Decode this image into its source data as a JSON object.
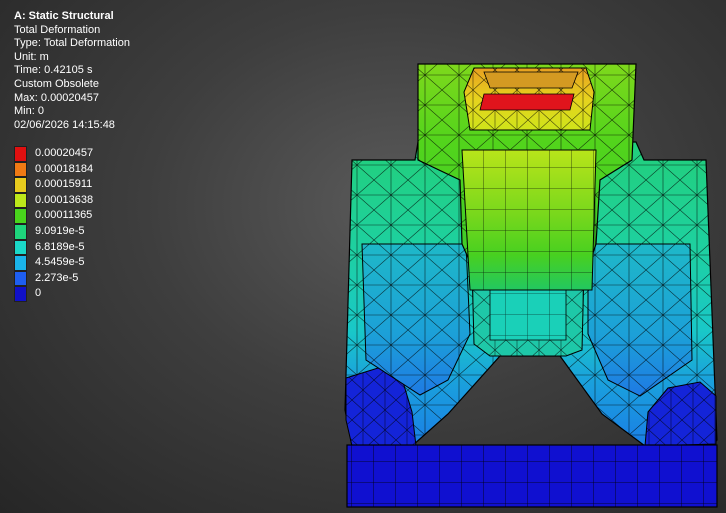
{
  "header": {
    "title": "A: Static Structural",
    "lines": [
      "Total Deformation",
      "Type: Total Deformation",
      "Unit: m",
      "Time: 0.42105 s",
      "Custom Obsolete",
      "Max: 0.00020457",
      "Min: 0",
      "02/06/2026 14:15:48"
    ]
  },
  "legend": {
    "levels": [
      {
        "label": "0.00020457",
        "color": "#e01010"
      },
      {
        "label": "0.00018184",
        "color": "#f07a14"
      },
      {
        "label": "0.00015911",
        "color": "#e8cc1e"
      },
      {
        "label": "0.00013638",
        "color": "#bde81a"
      },
      {
        "label": "0.00011365",
        "color": "#49d41c"
      },
      {
        "label": "9.0919e-5",
        "color": "#1ed47c"
      },
      {
        "label": "6.8189e-5",
        "color": "#1ad8c8"
      },
      {
        "label": "4.5459e-5",
        "color": "#1ab4ea"
      },
      {
        "label": "2.273e-5",
        "color": "#1e5ef0"
      },
      {
        "label": "0",
        "color": "#1010c8"
      }
    ]
  }
}
